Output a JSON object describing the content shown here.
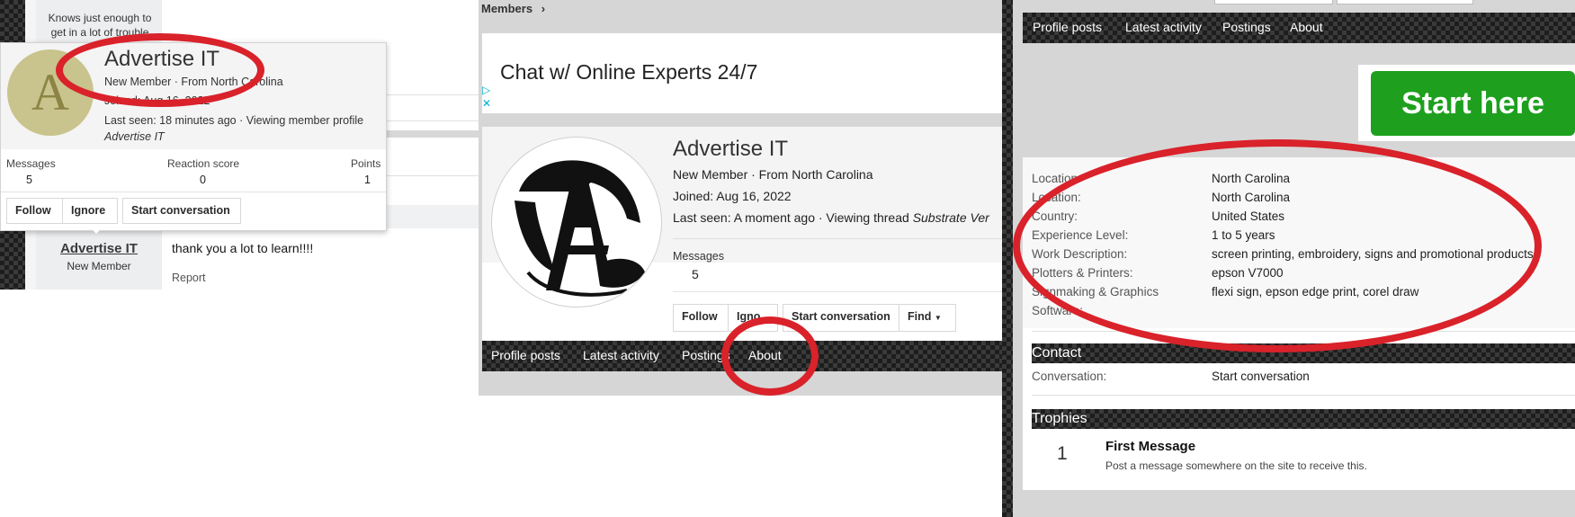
{
  "panel1": {
    "quote": "Knows just enough to get in a lot of trouble",
    "tooltip": {
      "avatar_letter": "A",
      "username": "Advertise IT",
      "role_from": "New Member · From North Carolina",
      "joined": "Joined: Aug 16, 2022",
      "last_seen": "Last seen: 18 minutes ago · Viewing member profile",
      "custom_title": "Advertise IT",
      "stats": [
        {
          "label": "Messages",
          "value": "5"
        },
        {
          "label": "Reaction score",
          "value": "0"
        },
        {
          "label": "Points",
          "value": "1"
        }
      ],
      "buttons": {
        "follow": "Follow",
        "ignore": "Ignore",
        "start": "Start conversation"
      }
    },
    "post": {
      "username": "Advertise IT",
      "role": "New Member",
      "message": "thank you a lot to learn!!!!",
      "report": "Report"
    }
  },
  "panel2": {
    "breadcrumb": "Members",
    "breadcrumb_sep": "›",
    "ad_text": "Chat w/ Online Experts 24/7",
    "ad_icon": "▷",
    "ad_close": "✕",
    "profile": {
      "username": "Advertise IT",
      "role_from": "New Member · From North Carolina",
      "joined": "Joined: Aug 16, 2022",
      "last_seen_prefix": "Last seen: A moment ago · Viewing thread ",
      "last_seen_thread": "Substrate Ver",
      "messages_label": "Messages",
      "messages_value": "5",
      "buttons": {
        "follow": "Follow",
        "ignore": "Igno",
        "start": "Start conversation",
        "find": "Find"
      }
    },
    "tabs": [
      "Profile posts",
      "Latest activity",
      "Postings",
      "About"
    ]
  },
  "panel3": {
    "tabs": [
      "Profile posts",
      "Latest activity",
      "Postings",
      "About"
    ],
    "ad_button": "Start here",
    "details": [
      {
        "label": "Location:",
        "value": "North Carolina"
      },
      {
        "label": "Location:",
        "value": "North Carolina"
      },
      {
        "label": "Country:",
        "value": "United States"
      },
      {
        "label": "Experience Level:",
        "value": "1 to 5 years"
      },
      {
        "label": "Work Description:",
        "value": "screen printing, embroidery, signs and promotional products"
      },
      {
        "label": "Plotters & Printers:",
        "value": "epson V7000"
      },
      {
        "label": "Signmaking & Graphics",
        "value": "flexi sign, epson edge print, corel draw"
      },
      {
        "label": "Software:",
        "value": ""
      }
    ],
    "contact": {
      "heading": "Contact",
      "label": "Conversation:",
      "value": "Start conversation"
    },
    "trophies": {
      "heading": "Trophies",
      "count": "1",
      "title": "First Message",
      "desc": "Post a message somewhere on the site to receive this."
    }
  },
  "colors": {
    "annotation_red": "#d9222a",
    "ad_green": "#1ea01e",
    "tooltip_avatar": "#c9c38d"
  }
}
